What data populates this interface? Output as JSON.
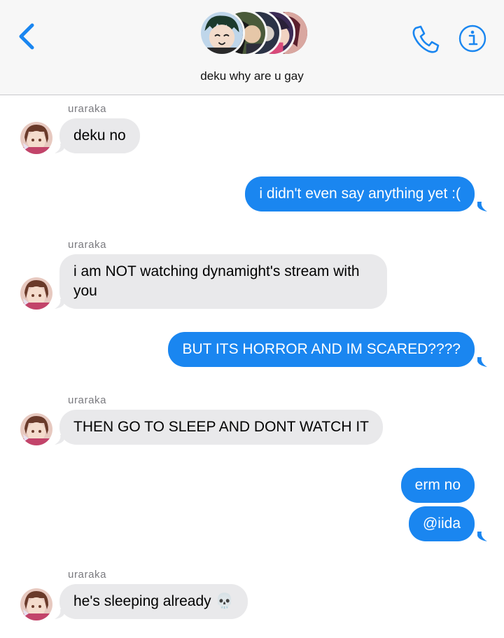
{
  "header": {
    "group_name": "deku why are u gay",
    "back_icon": "chevron-left-icon",
    "call_icon": "phone-icon",
    "info_icon": "info-icon",
    "accent_color": "#1a86f0"
  },
  "messages": [
    {
      "direction": "in",
      "sender": "uraraka",
      "text": "deku no"
    },
    {
      "direction": "out",
      "text": "i didn't even say anything yet :("
    },
    {
      "direction": "in",
      "sender": "uraraka",
      "text": "i am NOT watching dynamight's stream with you"
    },
    {
      "direction": "out",
      "text": "BUT ITS HORROR AND IM SCARED????"
    },
    {
      "direction": "in",
      "sender": "uraraka",
      "text": "THEN GO TO SLEEP AND DONT WATCH IT"
    },
    {
      "direction": "out",
      "text": "erm no"
    },
    {
      "direction": "out",
      "text": "@iida"
    },
    {
      "direction": "in",
      "sender": "uraraka",
      "text": "he's sleeping already 💀"
    }
  ],
  "colors": {
    "outgoing_bubble": "#1a86f0",
    "incoming_bubble": "#e9e9eb"
  }
}
